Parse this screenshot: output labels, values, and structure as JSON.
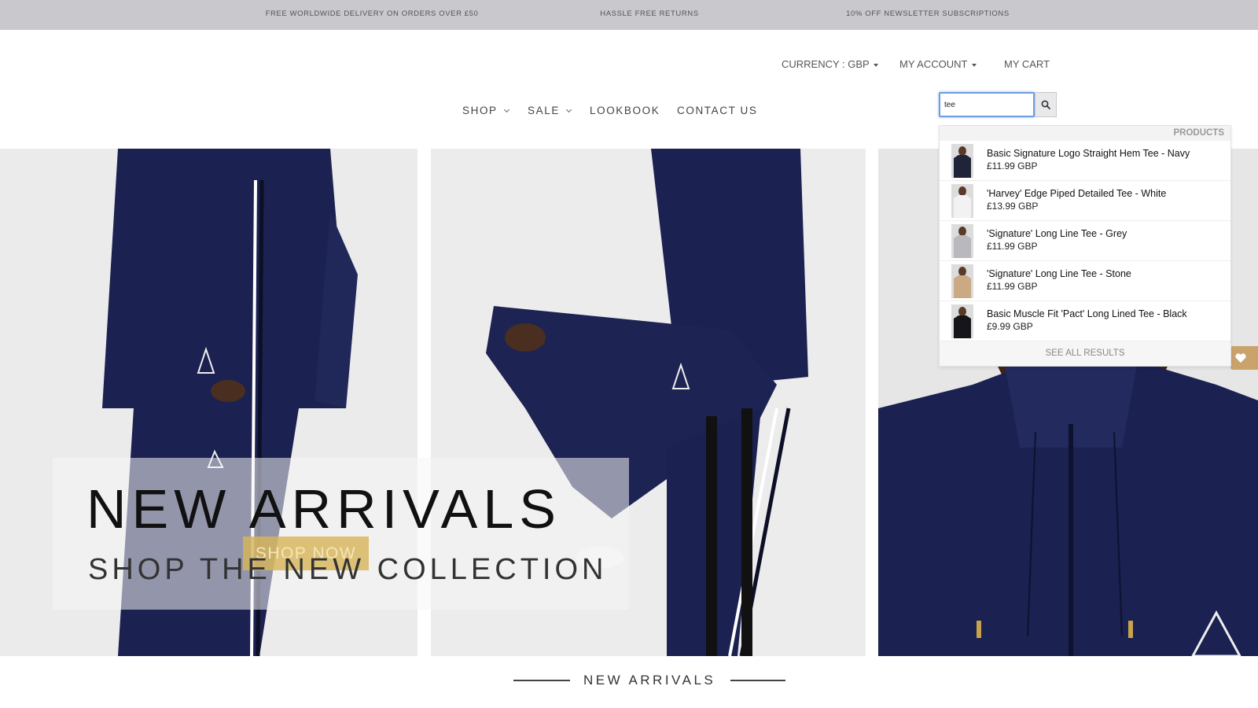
{
  "promo": [
    "FREE WORLDWIDE DELIVERY ON ORDERS OVER £50",
    "HASSLE FREE RETURNS",
    "10% OFF NEWSLETTER SUBSCRIPTIONS"
  ],
  "header": {
    "currency_label": "CURRENCY : GBP",
    "account_label": "MY ACCOUNT",
    "cart_label": "MY CART"
  },
  "nav": {
    "shop": "SHOP",
    "sale": "SALE",
    "lookbook": "LOOKBOOK",
    "contact": "CONTACT US"
  },
  "search": {
    "value": "tee",
    "icon": "search-icon"
  },
  "dropdown": {
    "section_label": "PRODUCTS",
    "items": [
      {
        "name": "Basic Signature Logo Straight Hem Tee - Navy",
        "price": "£11.99 GBP",
        "swatch": "#1f2438"
      },
      {
        "name": "'Harvey' Edge Piped Detailed Tee - White",
        "price": "£13.99 GBP",
        "swatch": "#f2f2f2"
      },
      {
        "name": "'Signature' Long Line Tee - Grey",
        "price": "£11.99 GBP",
        "swatch": "#b9b9bd"
      },
      {
        "name": "'Signature' Long Line Tee - Stone",
        "price": "£11.99 GBP",
        "swatch": "#c9aa82"
      },
      {
        "name": "Basic Muscle Fit 'Pact' Long Lined Tee - Black",
        "price": "£9.99 GBP",
        "swatch": "#16161a"
      }
    ],
    "see_all": "SEE ALL RESULTS"
  },
  "hero": {
    "title": "NEW ARRIVALS",
    "subtitle": "SHOP THE NEW COLLECTION",
    "cta": "SHOP NOW"
  },
  "section": {
    "title": "NEW ARRIVALS"
  },
  "colors": {
    "promo_bg": "#c8c8cd",
    "garment_navy": "#1b2150",
    "accent_gold": "#d7b45a",
    "search_focus": "#6b9ee0"
  }
}
